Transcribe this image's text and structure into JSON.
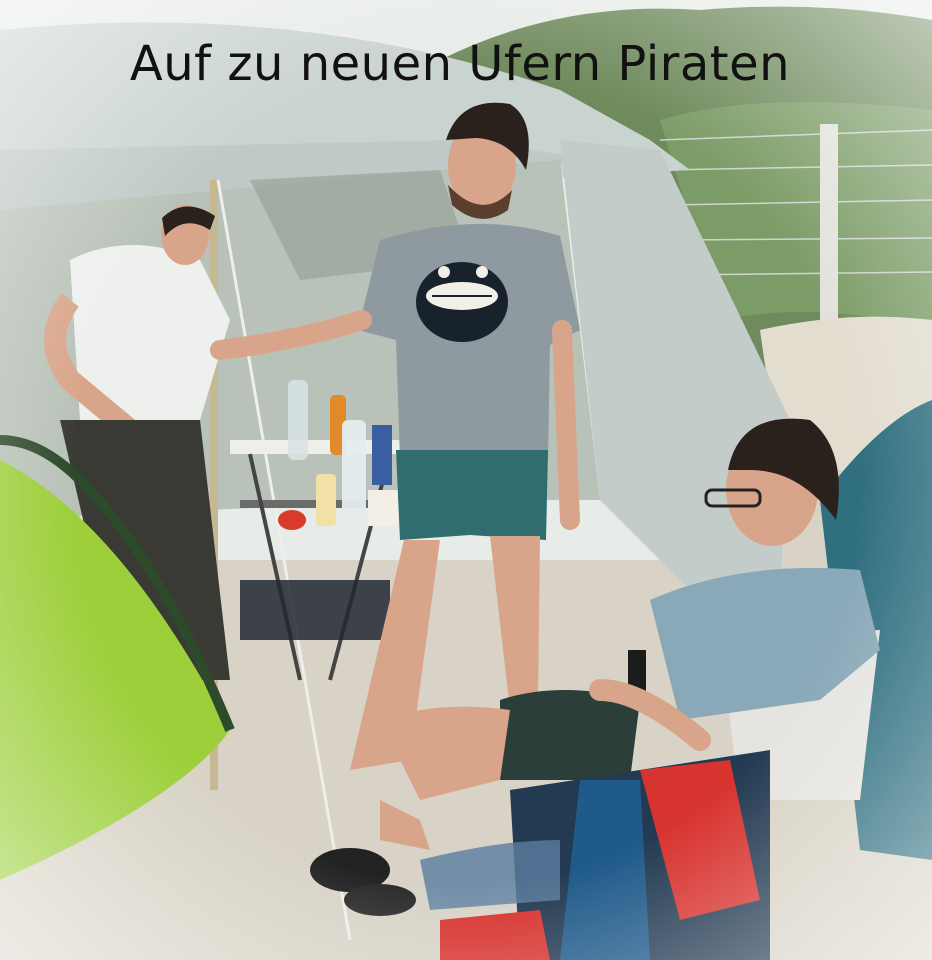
{
  "caption": "Auf zu neuen Ufern Piraten",
  "colors": {
    "sky": "#e8ece8",
    "dune": "#6f8a5c",
    "sand": "#d8d3c6",
    "tent_canvas": "#c9d3cf",
    "tent_inner": "#b9c2b8",
    "green_tent": "#9ccf3a",
    "blue_tent": "#2f6f80",
    "shirt_gray": "#8f9aa0",
    "shorts_teal": "#2f6d6f",
    "shirt_blue": "#89a8b8",
    "towel_red": "#d7332f",
    "towel_blue": "#1f5a8a",
    "skin": "#d9a58a"
  },
  "icons": {
    "shirt_print": "cartoon-face-icon",
    "bottle": "bottle-icon"
  }
}
